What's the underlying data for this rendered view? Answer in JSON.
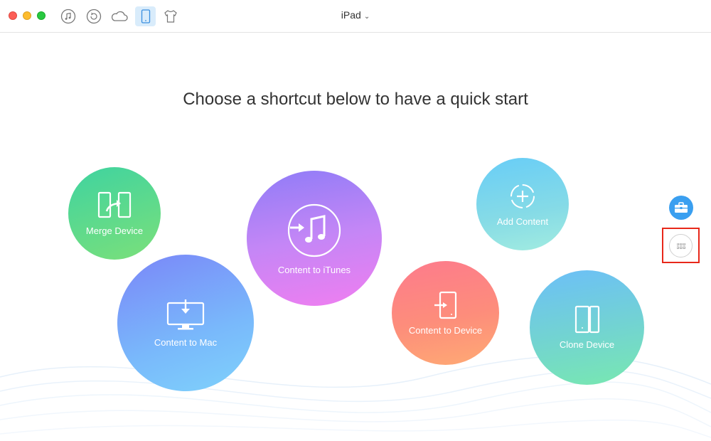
{
  "window": {
    "device_title": "iPad",
    "toolbar_icons": [
      "music-icon",
      "restore-icon",
      "cloud-icon",
      "ipad-icon",
      "tshirt-icon"
    ]
  },
  "main": {
    "heading": "Choose a shortcut below to have a quick start"
  },
  "shortcuts": {
    "merge_device": "Merge Device",
    "content_to_mac": "Content to Mac",
    "content_to_itunes": "Content to iTunes",
    "add_content": "Add Content",
    "content_to_device": "Content to Device",
    "clone_device": "Clone Device"
  },
  "side_buttons": [
    "toolbox-icon",
    "more-grid-icon"
  ],
  "colors": {
    "accent": "#3a9ff0",
    "highlight_box": "#e8281a"
  }
}
